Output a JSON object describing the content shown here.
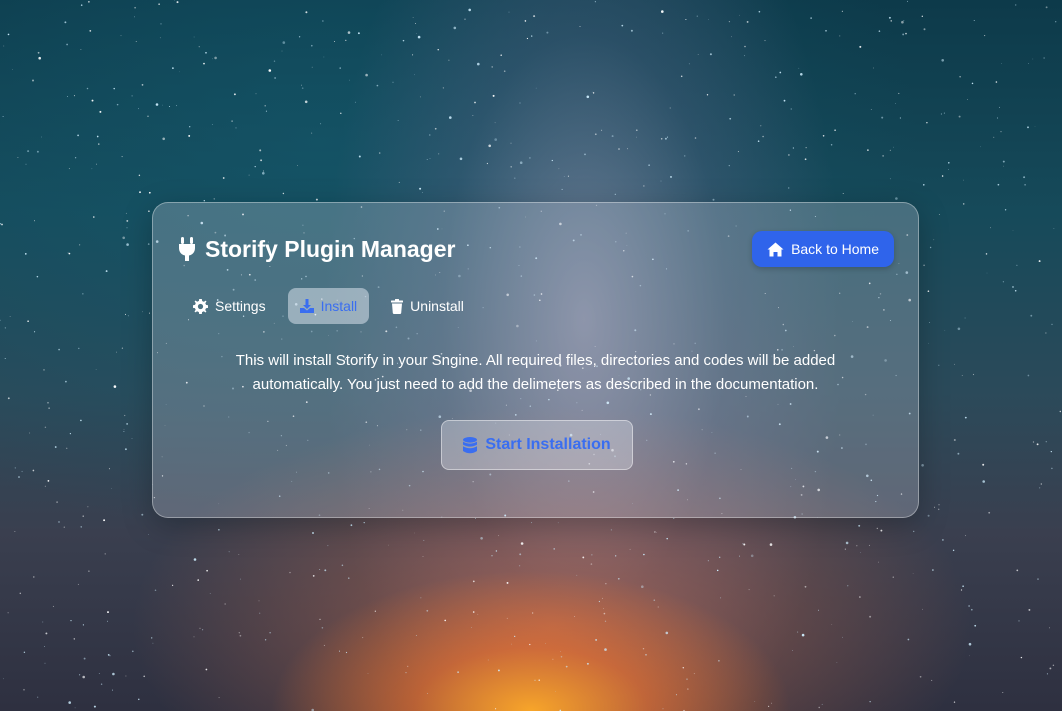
{
  "page": {
    "title": "Storify Plugin Manager",
    "back_button_label": "Back to Home"
  },
  "tabs": [
    {
      "label": "Settings",
      "icon": "gear-icon",
      "active": false
    },
    {
      "label": "Install",
      "icon": "download-icon",
      "active": true
    },
    {
      "label": "Uninstall",
      "icon": "trash-icon",
      "active": false
    }
  ],
  "install": {
    "description": "This will install Storify in your Sngine. All required files, directories and codes will be added automatically. You just need to add the delimeters as described in the documentation.",
    "start_button_label": "Start Installation",
    "start_button_icon": "database-icon"
  },
  "colors": {
    "accent": "#2f64eb",
    "active_tab_text": "#3a6ef0"
  }
}
